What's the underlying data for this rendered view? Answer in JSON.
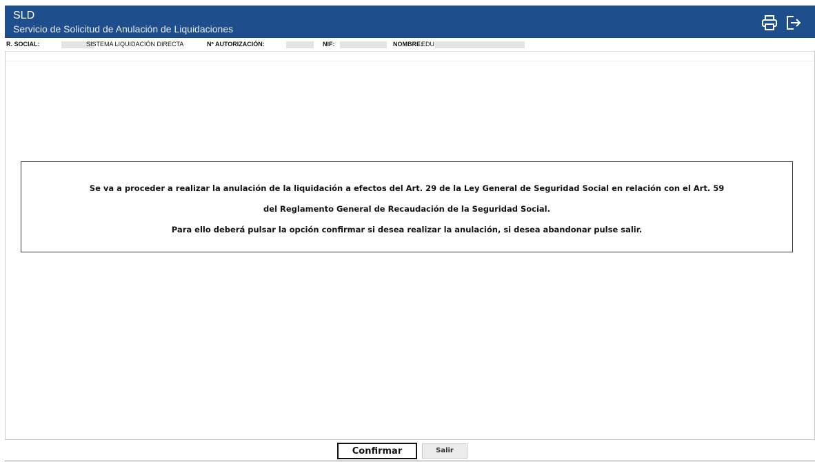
{
  "header": {
    "app_code": "SLD",
    "app_title": "Servicio de Solicitud de Anulación de Liquidaciones",
    "print_icon": "printer-icon",
    "logout_icon": "logout-icon",
    "background": "#1f4e8c"
  },
  "infobar": {
    "social_label": "R. SOCIAL:",
    "system_text": "SISTEMA LIQUIDACIÓN DIRECTA",
    "authorization_label": "Nº AUTORIZACIÓN:",
    "nif_label": "NIF:",
    "name_label": "NOMBRE:",
    "name_value": "EDU"
  },
  "notice": {
    "line1": "Se va a proceder a realizar la anulación de la liquidación a efectos del Art. 29 de la Ley General de Seguridad Social en relación con el Art. 59",
    "line2": "del Reglamento General de Recaudación de la Seguridad Social.",
    "line3": "Para ello deberá pulsar la opción confirmar si desea realizar la anulación, si  desea abandonar pulse salir."
  },
  "footer": {
    "confirm_label": "Confirmar",
    "exit_label": "Salir"
  }
}
